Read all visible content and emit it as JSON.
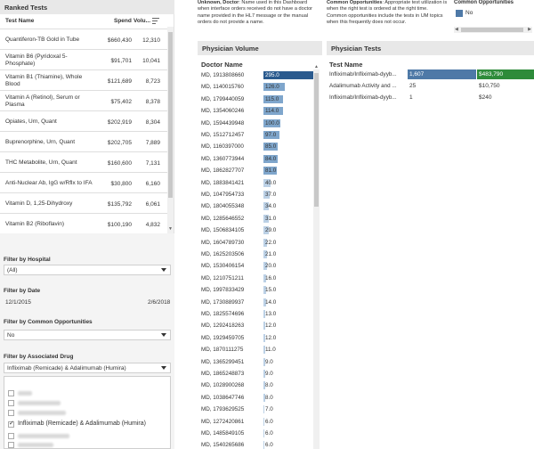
{
  "ranked_tests": {
    "title": "Ranked Tests",
    "col_test": "Test Name",
    "col_spend": "Spend",
    "col_volume": "Volu...",
    "rows": [
      {
        "name": "Quantiferon-TB Gold in Tube",
        "spend": "$660,430",
        "volume": "12,310"
      },
      {
        "name": "Vitamin B6 (Pyridoxal 5-Phosphate)",
        "spend": "$91,701",
        "volume": "10,041"
      },
      {
        "name": "Vitamin B1 (Thiamine), Whole Blood",
        "spend": "$121,689",
        "volume": "8,723"
      },
      {
        "name": "Vitamin A (Retinol), Serum or Plasma",
        "spend": "$75,402",
        "volume": "8,378"
      },
      {
        "name": "Opiates, Urn, Quant",
        "spend": "$202,919",
        "volume": "8,304"
      },
      {
        "name": "Buprenorphine, Urn, Quant",
        "spend": "$202,705",
        "volume": "7,889"
      },
      {
        "name": "THC Metabolite, Urn, Quant",
        "spend": "$160,600",
        "volume": "7,131"
      },
      {
        "name": "Anti-Nuclear Ab, IgG w/Rflx to IFA",
        "spend": "$30,800",
        "volume": "6,160"
      },
      {
        "name": "Vitamin D, 1,25-Dihydroxy",
        "spend": "$135,792",
        "volume": "6,061"
      },
      {
        "name": "Vitamin B2 (Riboflavin)",
        "spend": "$100,190",
        "volume": "4,832"
      }
    ]
  },
  "filters": {
    "hospital_label": "Filter by Hospital",
    "hospital_value": "(All)",
    "date_label": "Filter by Date",
    "date_start": "12/1/2015",
    "date_end": "2/6/2018",
    "common_label": "Filter by Common Opportunities",
    "common_value": "No",
    "drug_label": "Filter by Associated Drug",
    "drug_value": "Infliximab (Remicade) & Adalimumab (Humira)",
    "drug_checked_item": "Infliximab (Remicade) & Adalimumab (Humira)"
  },
  "info": {
    "unknown_doctor_bold": "Unknown, Doctor",
    "unknown_doctor_text": ": Name used in this Dashboard when interface orders received do not have a doctor name provided in the HL7 message or the manual orders do not provide a name.",
    "common_opp_bold": "Common Opportunities",
    "common_opp_text": ": Appropriate test utilization is when the right test is ordered at the right time. Common opportunities include the tests in UM topics when this frequently does not occur."
  },
  "legend": {
    "title": "Common Opportunities",
    "item": "No",
    "color": "#4e79a7"
  },
  "physician_volume": {
    "title": "Physician Volume",
    "col_doctor": "Doctor Name",
    "max": 295,
    "rows": [
      {
        "name": "MD, 1913808660",
        "value": 295,
        "label": "295.0"
      },
      {
        "name": "MD, 1140015760",
        "value": 126,
        "label": "126.0"
      },
      {
        "name": "MD, 1799440059",
        "value": 115,
        "label": "115.0"
      },
      {
        "name": "MD, 1354060246",
        "value": 114,
        "label": "114.0"
      },
      {
        "name": "MD, 1594439948",
        "value": 100,
        "label": "100.0"
      },
      {
        "name": "MD, 1512712457",
        "value": 97,
        "label": "97.0"
      },
      {
        "name": "MD, 1160397000",
        "value": 85,
        "label": "85.0"
      },
      {
        "name": "MD, 1360773944",
        "value": 84,
        "label": "84.0"
      },
      {
        "name": "MD, 1862827707",
        "value": 81,
        "label": "81.0"
      },
      {
        "name": "MD, 1883841421",
        "value": 40,
        "label": "40.0"
      },
      {
        "name": "MD, 1047954733",
        "value": 37,
        "label": "37.0"
      },
      {
        "name": "MD, 1804055348",
        "value": 34,
        "label": "34.0"
      },
      {
        "name": "MD, 1285646552",
        "value": 31,
        "label": "31.0"
      },
      {
        "name": "MD, 1506834105",
        "value": 29,
        "label": "29.0"
      },
      {
        "name": "MD, 1604789730",
        "value": 22,
        "label": "22.0"
      },
      {
        "name": "MD, 1625203506",
        "value": 21,
        "label": "21.0"
      },
      {
        "name": "MD, 1530406154",
        "value": 20,
        "label": "20.0"
      },
      {
        "name": "MD, 1210751211",
        "value": 16,
        "label": "16.0"
      },
      {
        "name": "MD, 1997833429",
        "value": 15,
        "label": "15.0"
      },
      {
        "name": "MD, 1730889937",
        "value": 14,
        "label": "14.0"
      },
      {
        "name": "MD, 1825574696",
        "value": 13,
        "label": "13.0"
      },
      {
        "name": "MD, 1292418263",
        "value": 12,
        "label": "12.0"
      },
      {
        "name": "MD, 1929459705",
        "value": 12,
        "label": "12.0"
      },
      {
        "name": "MD, 1870111275",
        "value": 11,
        "label": "11.0"
      },
      {
        "name": "MD, 1365299451",
        "value": 9,
        "label": "9.0"
      },
      {
        "name": "MD, 1865248873",
        "value": 9,
        "label": "9.0"
      },
      {
        "name": "MD, 1028900268",
        "value": 8,
        "label": "8.0"
      },
      {
        "name": "MD, 1038647746",
        "value": 8,
        "label": "8.0"
      },
      {
        "name": "MD, 1793629525",
        "value": 7,
        "label": "7.0"
      },
      {
        "name": "MD, 1272420861",
        "value": 6,
        "label": "6.0"
      },
      {
        "name": "MD, 1485849105",
        "value": 6,
        "label": "6.0"
      },
      {
        "name": "MD, 1540265686",
        "value": 6,
        "label": "6.0"
      }
    ]
  },
  "physician_tests": {
    "title": "Physician Tests",
    "col_test": "Test Name",
    "rows": [
      {
        "name": "Infliximab/Infliximab-dyyb...",
        "qty": "1,607",
        "spend": "$483,790",
        "filled": true
      },
      {
        "name": "Adalimumab Activity and ...",
        "qty": "25",
        "spend": "$10,750",
        "filled": false
      },
      {
        "name": "Infliximab/Infliximab-dyyb...",
        "qty": "1",
        "spend": "$240",
        "filled": false
      }
    ]
  }
}
